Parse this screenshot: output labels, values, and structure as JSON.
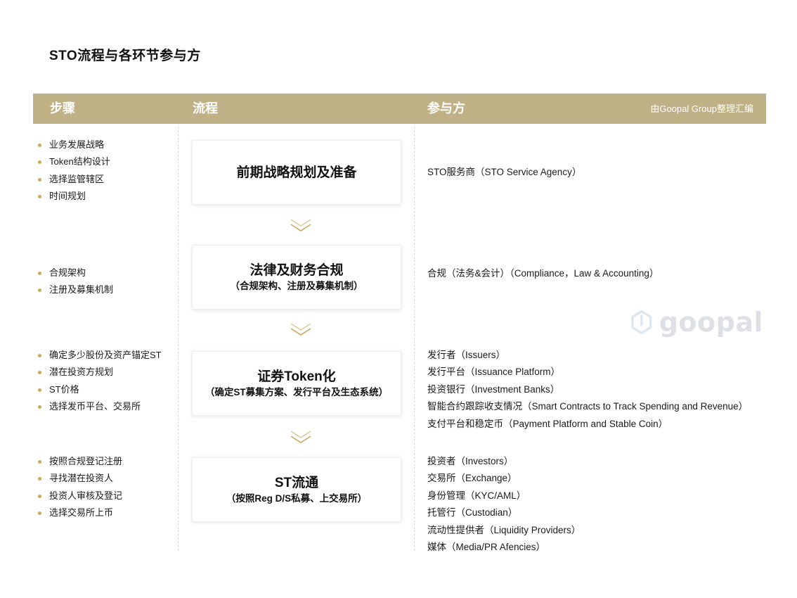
{
  "page_title": "STO流程与各环节参与方",
  "header": {
    "col_steps": "步骤",
    "col_process": "流程",
    "col_parties": "参与方",
    "credit": "由Goopal Group整理汇编"
  },
  "accent_color": "#bfb085",
  "bullet_color": "#c9a95f",
  "stages": [
    {
      "steps": [
        "业务发展战略",
        "Token结构设计",
        "选择监管辖区",
        "时间规划"
      ],
      "title": "前期战略规划及准备",
      "subtitle": "",
      "parties": [
        "STO服务商（STO Service Agency）"
      ]
    },
    {
      "steps": [
        "合规架构",
        "注册及募集机制"
      ],
      "title": "法律及财务合规",
      "subtitle": "（合规架构、注册及募集机制）",
      "parties": [
        "合规（法务&会计）（Compliance，Law & Accounting）"
      ]
    },
    {
      "steps": [
        "确定多少股份及资产锚定ST",
        "潜在投资方规划",
        "ST价格",
        "选择发币平台、交易所"
      ],
      "title": "证券Token化",
      "subtitle": "（确定ST募集方案、发行平台及生态系统）",
      "parties": [
        "发行者（Issuers）",
        "发行平台（Issuance Platform）",
        "投资银行（Investment Banks）",
        "智能合约跟踪收支情况（Smart Contracts to Track Spending and Revenue）",
        "支付平台和稳定币（Payment Platform and Stable Coin）"
      ]
    },
    {
      "steps": [
        "按照合规登记注册",
        "寻找潜在投资人",
        "投资人审核及登记",
        "选择交易所上币"
      ],
      "title": "ST流通",
      "subtitle": "（按照Reg D/S私募、上交易所）",
      "parties": [
        "投资者（Investors）",
        "交易所（Exchange）",
        "身份管理（KYC/AML）",
        "托管行（Custodian）",
        "流动性提供者（Liquidity Providers）",
        "媒体（Media/PR Afencies）"
      ]
    }
  ],
  "watermark": {
    "text": "goopal",
    "icon": "goopal-logo-icon"
  }
}
